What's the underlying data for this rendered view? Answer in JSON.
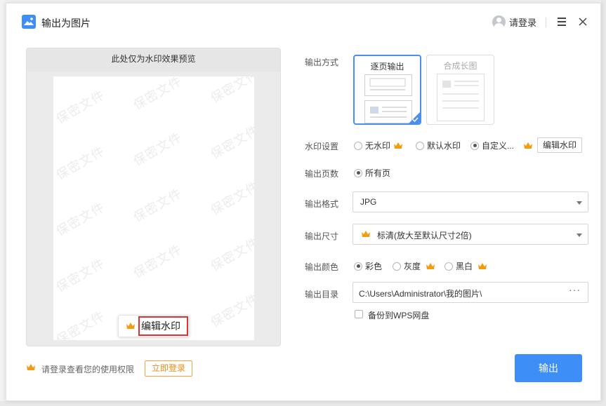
{
  "window": {
    "title": "输出为图片",
    "login_label": "请登录"
  },
  "preview": {
    "header": "此处仅为水印效果预览",
    "watermark_text": "保密文件",
    "edit_watermark_label": "编辑水印"
  },
  "permission": {
    "text": "请登录查看您的使用权限",
    "login_button": "立即登录"
  },
  "settings": {
    "output_mode": {
      "label": "输出方式",
      "options": [
        "逐页输出",
        "合成长图"
      ],
      "selected": "逐页输出"
    },
    "watermark": {
      "label": "水印设置",
      "options": [
        "无水印",
        "默认水印",
        "自定义..."
      ],
      "selected": "自定义...",
      "edit_button": "编辑水印"
    },
    "pages": {
      "label": "输出页数",
      "option": "所有页"
    },
    "format": {
      "label": "输出格式",
      "value": "JPG"
    },
    "size": {
      "label": "输出尺寸",
      "value": "标清(放大至默认尺寸2倍)"
    },
    "color": {
      "label": "输出颜色",
      "options": [
        "彩色",
        "灰度",
        "黑白"
      ],
      "selected": "彩色"
    },
    "directory": {
      "label": "输出目录",
      "path": "C:\\Users\\Administrator\\我的图片\\",
      "more": "···",
      "backup_label": "备份到WPS网盘"
    }
  },
  "actions": {
    "export_label": "输出"
  },
  "colors": {
    "accent": "#3d8ef7",
    "crown": "#f39c12",
    "highlight_box": "#e03030"
  }
}
